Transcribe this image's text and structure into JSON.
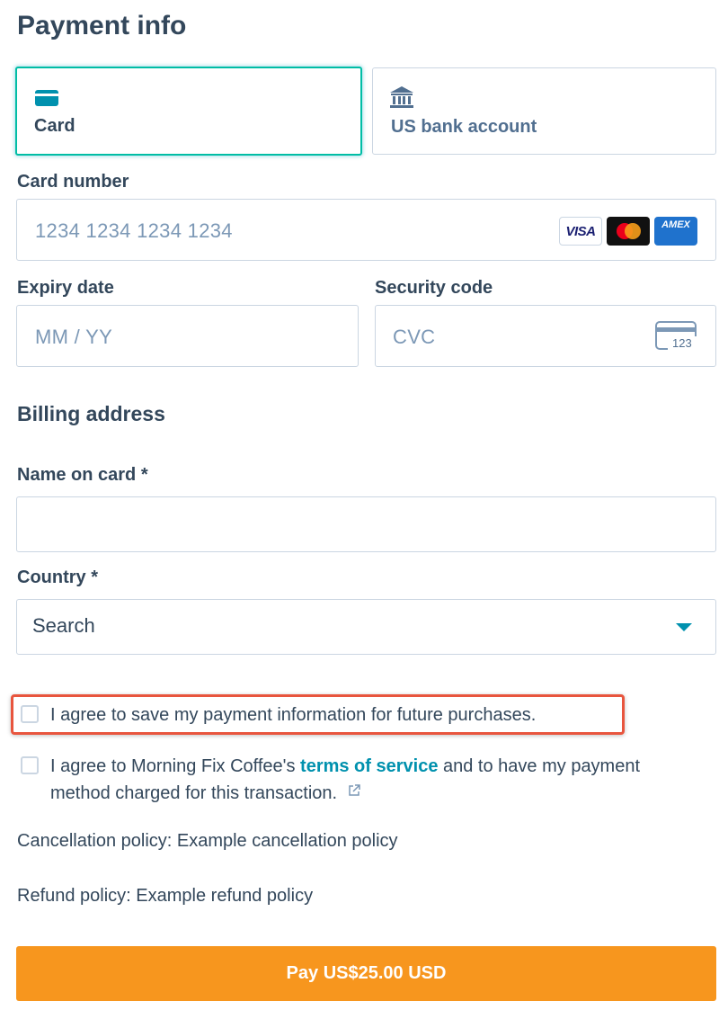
{
  "title": "Payment info",
  "tabs": [
    {
      "label": "Card",
      "icon": "credit-card-icon",
      "selected": true
    },
    {
      "label": "US bank account",
      "icon": "bank-icon",
      "selected": false
    }
  ],
  "card_number": {
    "label": "Card number",
    "placeholder": "1234 1234 1234 1234",
    "brands": [
      "VISA",
      "Mastercard",
      "AMEX"
    ]
  },
  "expiry": {
    "label": "Expiry date",
    "placeholder": "MM / YY"
  },
  "security": {
    "label": "Security code",
    "placeholder": "CVC",
    "icon_text": "123"
  },
  "billing": {
    "heading": "Billing address"
  },
  "name": {
    "label": "Name on card *",
    "value": ""
  },
  "country": {
    "label": "Country *",
    "value": "Search"
  },
  "save_checkbox": {
    "label": "I agree to save my payment information for future purchases.",
    "checked": false
  },
  "terms_checkbox": {
    "prefix": "I agree to Morning Fix Coffee's ",
    "link": "terms of service",
    "suffix": " and to have my payment method charged for this transaction.",
    "checked": false
  },
  "policies": {
    "cancellation": "Cancellation policy: Example cancellation policy",
    "refund": "Refund policy: Example refund policy"
  },
  "pay_button": "Pay US$25.00 USD",
  "colors": {
    "accent": "#0091ae",
    "selected_border": "#00bda5",
    "pay": "#f7961e",
    "highlight": "#e8553e"
  }
}
